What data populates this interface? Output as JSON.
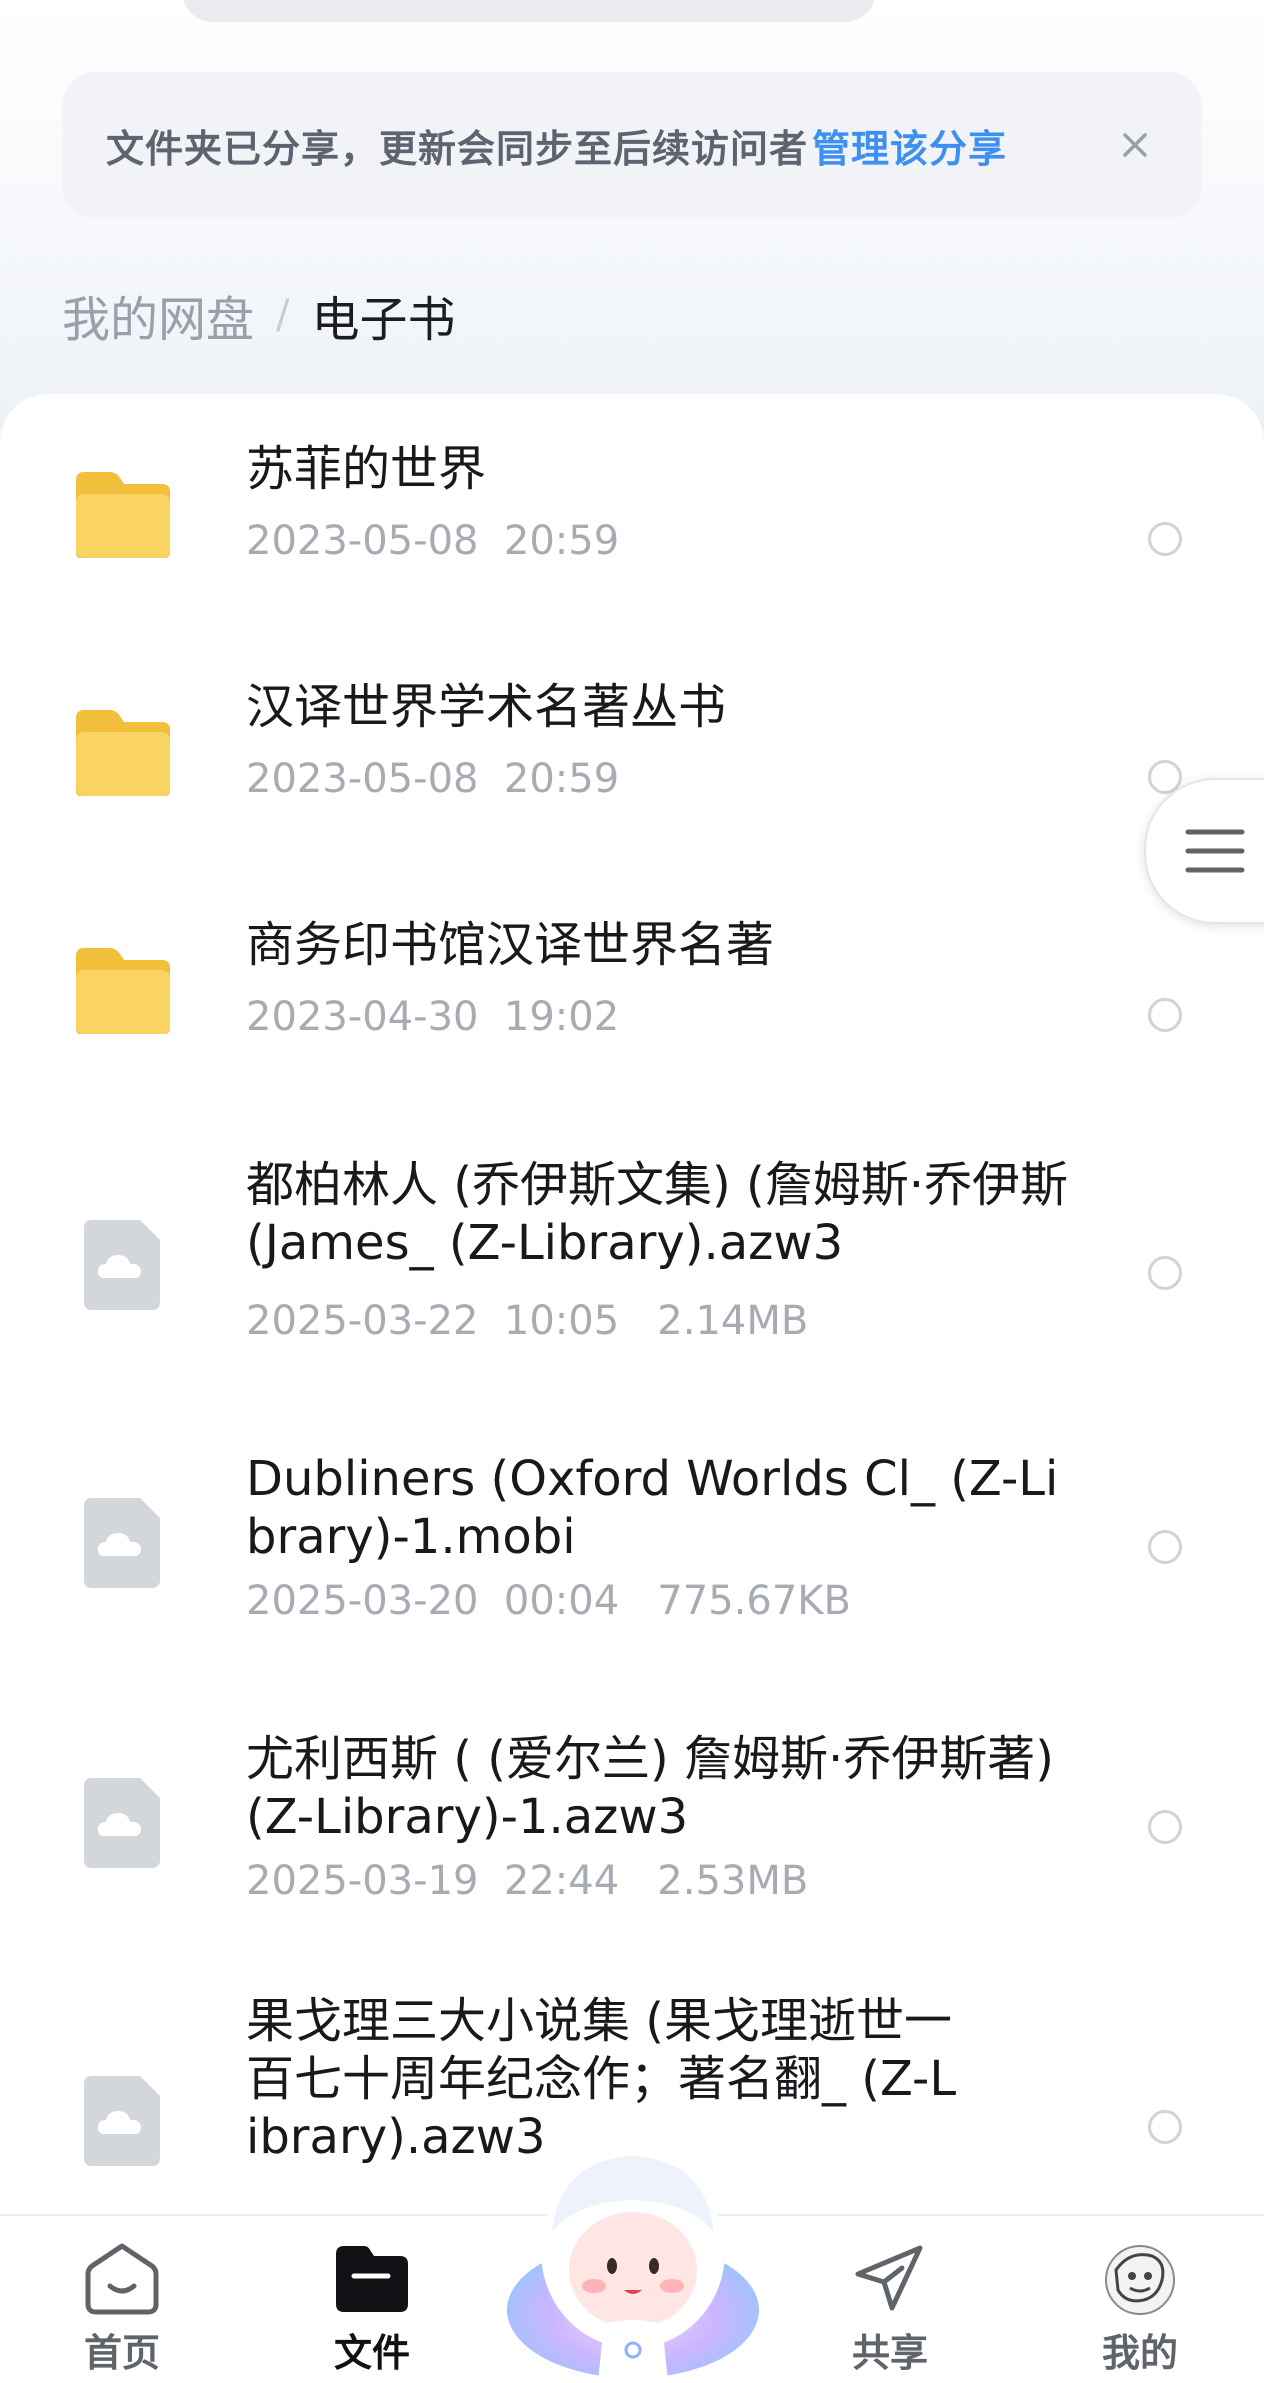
{
  "banner": {
    "text": "文件夹已分享，更新会同步至后续访问者",
    "link": "管理该分享"
  },
  "breadcrumb": {
    "root": "我的网盘",
    "separator": "/",
    "current": "电子书"
  },
  "files": [
    {
      "name": "苏菲的世界",
      "meta": "2023-05-08  20:59",
      "icon": "folder-icon"
    },
    {
      "name": "汉译世界学术名著丛书",
      "meta": "2023-05-08  20:59",
      "icon": "folder-icon"
    },
    {
      "name": "商务印书馆汉译世界名著",
      "meta": "2023-04-30  19:02",
      "icon": "folder-icon"
    },
    {
      "name": "都柏林人 (乔伊斯文集) (詹姆斯·乔伊斯(James_ (Z-Library).azw3",
      "meta": "2025-03-22  10:05   2.14MB",
      "icon": "cloud-file-icon"
    },
    {
      "name": "Dubliners (Oxford Worlds Cl_ (Z-Library)-1.mobi",
      "meta": "2025-03-20  00:04   775.67KB",
      "icon": "cloud-file-icon"
    },
    {
      "name": "尤利西斯 ( (爱尔兰) 詹姆斯·乔伊斯著) (Z-Library)-1.azw3",
      "meta": "2025-03-19  22:44   2.53MB",
      "icon": "cloud-file-icon"
    },
    {
      "name": "果戈理三大小说集 (果戈理逝世一百七十周年纪念作；著名翻_ (Z-Library).azw3",
      "meta": "",
      "icon": "cloud-file-icon"
    }
  ],
  "tabs": [
    {
      "label": "首页",
      "icon": "home-icon"
    },
    {
      "label": "文件",
      "icon": "folder-icon",
      "active": true
    },
    {
      "label": "共享",
      "icon": "send-icon"
    },
    {
      "label": "我的",
      "icon": "avatar"
    }
  ],
  "colors": {
    "accent": "#3d8ff0",
    "folder": "#f7cf54",
    "text_primary": "#17191d",
    "text_secondary": "#a7abb3"
  }
}
